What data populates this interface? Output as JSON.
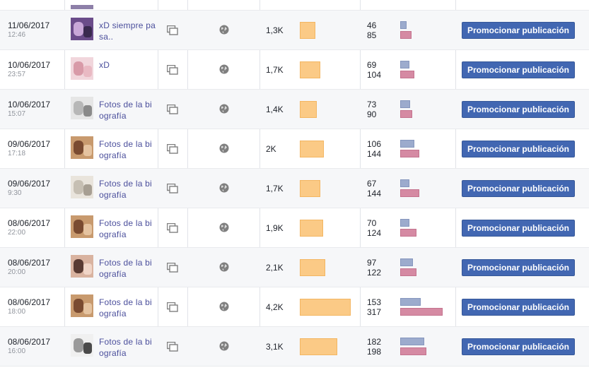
{
  "actions": {
    "promote_label": "Promocionar publicación"
  },
  "colors": {
    "reach_bar": "#fbca86",
    "engagement_bar_top": "#9cabcd",
    "engagement_bar_bottom": "#d58aa3",
    "promote_button": "#4267b2"
  },
  "icons": {
    "type": "copy-icon",
    "audience": "globe-icon"
  },
  "reach_scale_max": 4.2,
  "engagement_scale_max": 317,
  "posts": [
    {
      "date": "11/06/2017",
      "time": "12:46",
      "title": "xD siempre pasa..",
      "reach": "1,3K",
      "reach_value": 1.3,
      "engagement_top": "46",
      "engagement_bottom": "85",
      "thumb": "purple"
    },
    {
      "date": "10/06/2017",
      "time": "23:57",
      "title": "xD",
      "reach": "1,7K",
      "reach_value": 1.7,
      "engagement_top": "69",
      "engagement_bottom": "104",
      "thumb": "pink"
    },
    {
      "date": "10/06/2017",
      "time": "15:07",
      "title": "Fotos de la biografía",
      "reach": "1,4K",
      "reach_value": 1.4,
      "engagement_top": "73",
      "engagement_bottom": "90",
      "thumb": "grey"
    },
    {
      "date": "09/06/2017",
      "time": "17:18",
      "title": "Fotos de la biografía",
      "reach": "2K",
      "reach_value": 2.0,
      "engagement_top": "106",
      "engagement_bottom": "144",
      "thumb": "warm"
    },
    {
      "date": "09/06/2017",
      "time": "9:30",
      "title": "Fotos de la biografía",
      "reach": "1,7K",
      "reach_value": 1.7,
      "engagement_top": "67",
      "engagement_bottom": "144",
      "thumb": "light"
    },
    {
      "date": "08/06/2017",
      "time": "22:00",
      "title": "Fotos de la biografía",
      "reach": "1,9K",
      "reach_value": 1.9,
      "engagement_top": "70",
      "engagement_bottom": "124",
      "thumb": "warm"
    },
    {
      "date": "08/06/2017",
      "time": "20:00",
      "title": "Fotos de la biografía",
      "reach": "2,1K",
      "reach_value": 2.1,
      "engagement_top": "97",
      "engagement_bottom": "122",
      "thumb": "face"
    },
    {
      "date": "08/06/2017",
      "time": "18:00",
      "title": "Fotos de la biografía",
      "reach": "4,2K",
      "reach_value": 4.2,
      "engagement_top": "153",
      "engagement_bottom": "317",
      "thumb": "warm"
    },
    {
      "date": "08/06/2017",
      "time": "16:00",
      "title": "Fotos de la biografía",
      "reach": "3,1K",
      "reach_value": 3.1,
      "engagement_top": "182",
      "engagement_bottom": "198",
      "thumb": "comic"
    }
  ]
}
